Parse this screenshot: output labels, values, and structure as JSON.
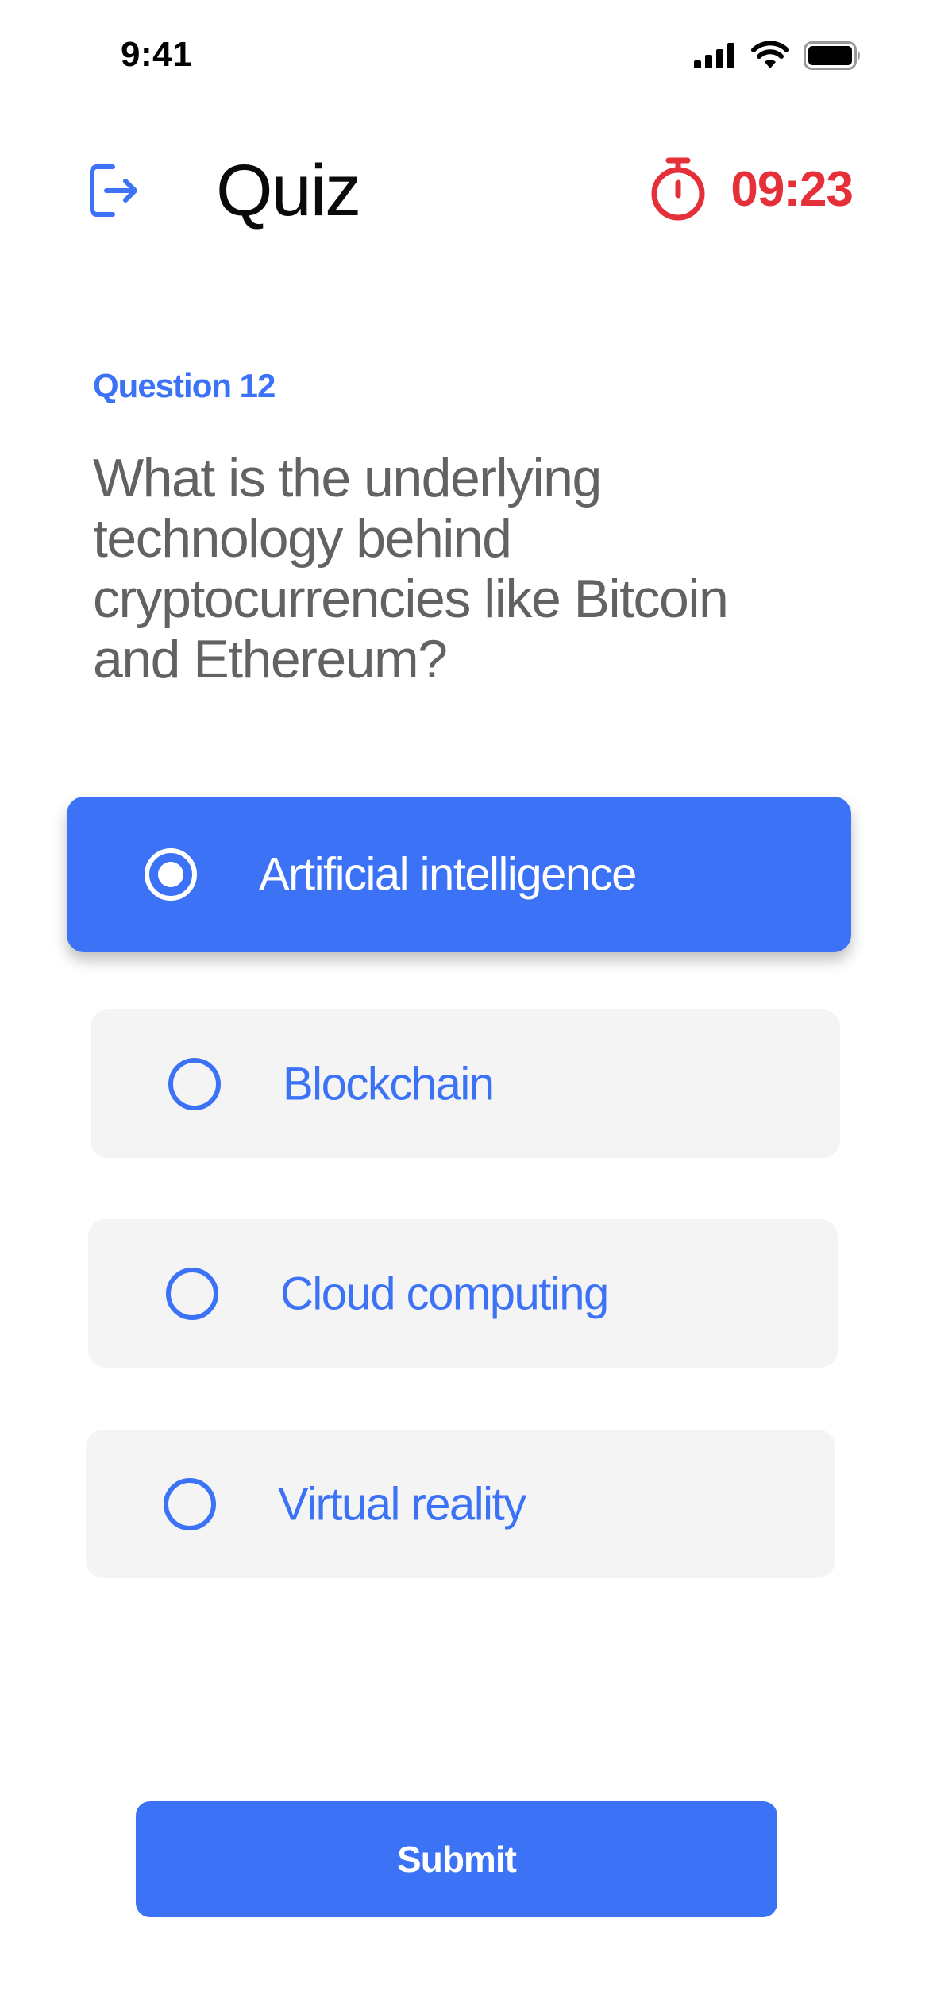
{
  "status_bar": {
    "time": "9:41",
    "icons": [
      "cellular-signal-icon",
      "wifi-icon",
      "battery-icon"
    ]
  },
  "header": {
    "exit_icon": "exit-icon",
    "title": "Quiz",
    "timer_icon": "stopwatch-icon",
    "timer_value": "09:23"
  },
  "question": {
    "number_label": "Question 12",
    "text": "What is the underlying technology behind cryptocurrencies like Bitcoin and Ethereum?"
  },
  "options": [
    {
      "label": "Artificial intelligence",
      "selected": true
    },
    {
      "label": "Blockchain",
      "selected": false
    },
    {
      "label": "Cloud computing",
      "selected": false
    },
    {
      "label": "Virtual reality",
      "selected": false
    }
  ],
  "submit_label": "Submit",
  "colors": {
    "accent": "#3b72f6",
    "timer": "#e5303a",
    "option_background": "#f4f4f4",
    "question_text": "#626262"
  }
}
